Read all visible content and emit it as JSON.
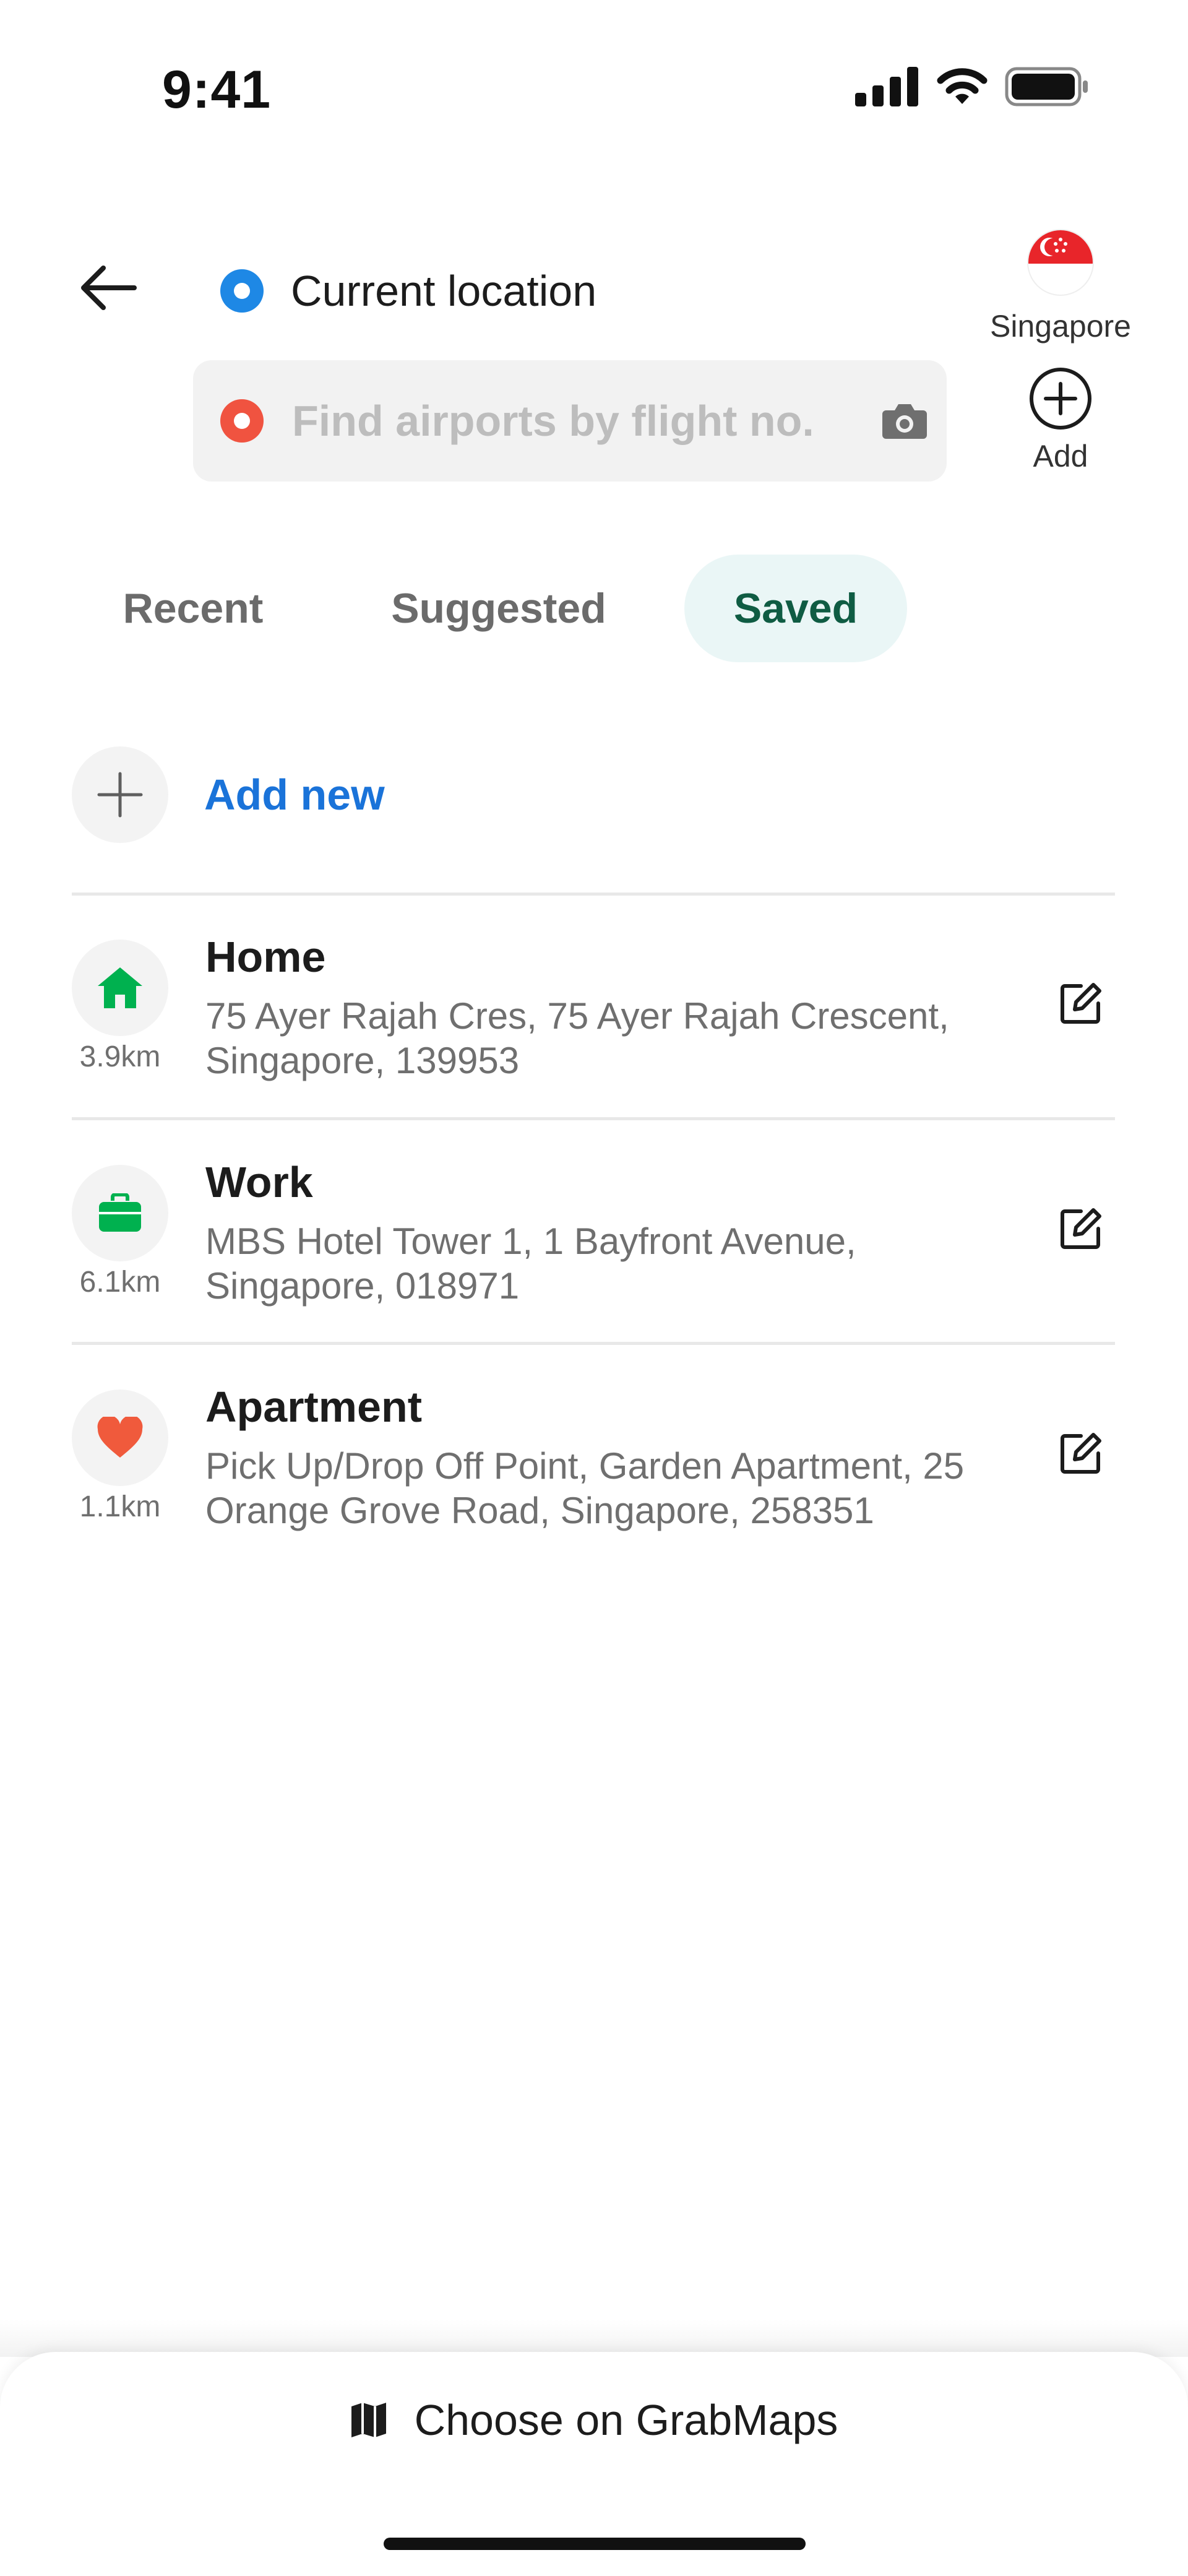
{
  "status_bar": {
    "time": "9:41"
  },
  "header": {
    "origin_label": "Current location",
    "search": {
      "value": "",
      "placeholder": "Find airports by flight no."
    },
    "region_label": "Singapore",
    "add_label": "Add"
  },
  "tabs": [
    {
      "label": "Recent",
      "active": false
    },
    {
      "label": "Suggested",
      "active": false
    },
    {
      "label": "Saved",
      "active": true
    }
  ],
  "add_new_label": "Add new",
  "saved_places": [
    {
      "name": "Home",
      "distance": "3.9km",
      "address_line1": "75 Ayer Rajah Cres, 75 Ayer Rajah Crescent,",
      "address_line2": "Singapore, 139953",
      "icon": "home-icon"
    },
    {
      "name": "Work",
      "distance": "6.1km",
      "address_line1": "MBS Hotel Tower 1, 1 Bayfront Avenue,",
      "address_line2": "Singapore, 018971",
      "icon": "briefcase-icon"
    },
    {
      "name": "Apartment",
      "distance": "1.1km",
      "address_line1": "Pick Up/Drop Off Point, Garden Apartment, 25",
      "address_line2": "Orange Grove Road, Singapore, 258351",
      "icon": "heart-icon"
    }
  ],
  "bottom_sheet": {
    "choose_on_map_label": "Choose on GrabMaps"
  },
  "colors": {
    "origin_dot": "#1e88e5",
    "destination_dot": "#f05340",
    "active_tab_bg": "#eaf6f6",
    "active_tab_text": "#0f5c43",
    "link_blue": "#1a73d9",
    "home_green": "#00b14f",
    "work_green": "#00b14f",
    "heart_red": "#f05a3c"
  }
}
